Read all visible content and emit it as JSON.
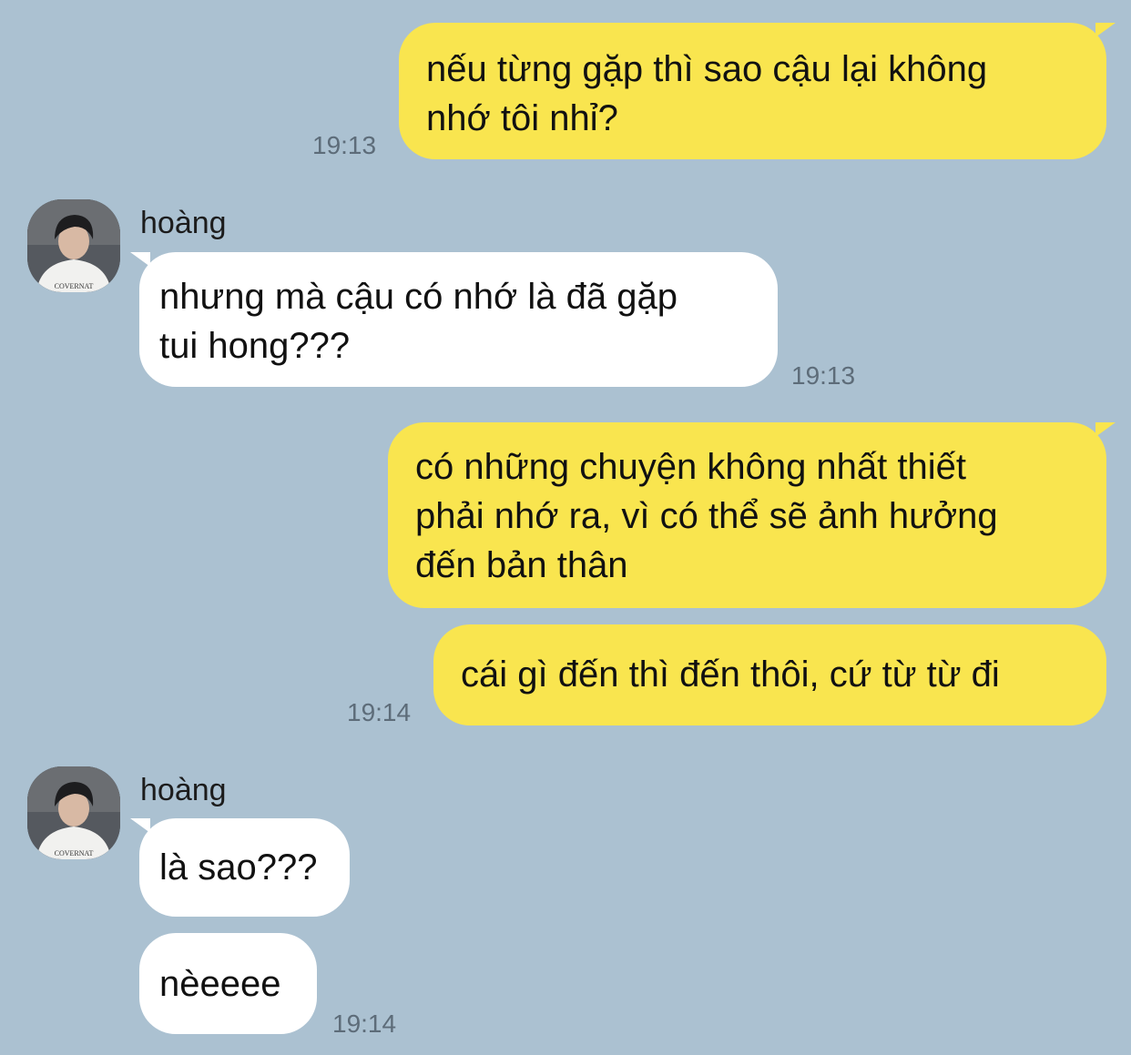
{
  "messages": [
    {
      "from": "me",
      "text": "nếu từng gặp thì sao cậu lại không\nnhớ tôi nhỉ?",
      "time": "19:13"
    },
    {
      "from": "them",
      "sender": "hoàng",
      "avatar_icon": "profile-photo",
      "text": "nhưng mà cậu có nhớ là đã gặp\ntui hong???",
      "time": "19:13"
    },
    {
      "from": "me",
      "text": "có những chuyện không nhất thiết\nphải nhớ ra, vì có thể sẽ ảnh hưởng\nđến bản thân"
    },
    {
      "from": "me",
      "text": "cái gì đến thì đến thôi, cứ từ từ đi",
      "time": "19:14"
    },
    {
      "from": "them",
      "sender": "hoàng",
      "avatar_icon": "profile-photo",
      "text": "là sao???"
    },
    {
      "from": "them",
      "text": "nèeeee",
      "time": "19:14"
    }
  ],
  "avatar_shirt_text": "COVERNAT",
  "colors": {
    "background": "#abc1d1",
    "my_bubble": "#f9e54f",
    "their_bubble": "#ffffff",
    "timestamp": "#5d6c79"
  }
}
